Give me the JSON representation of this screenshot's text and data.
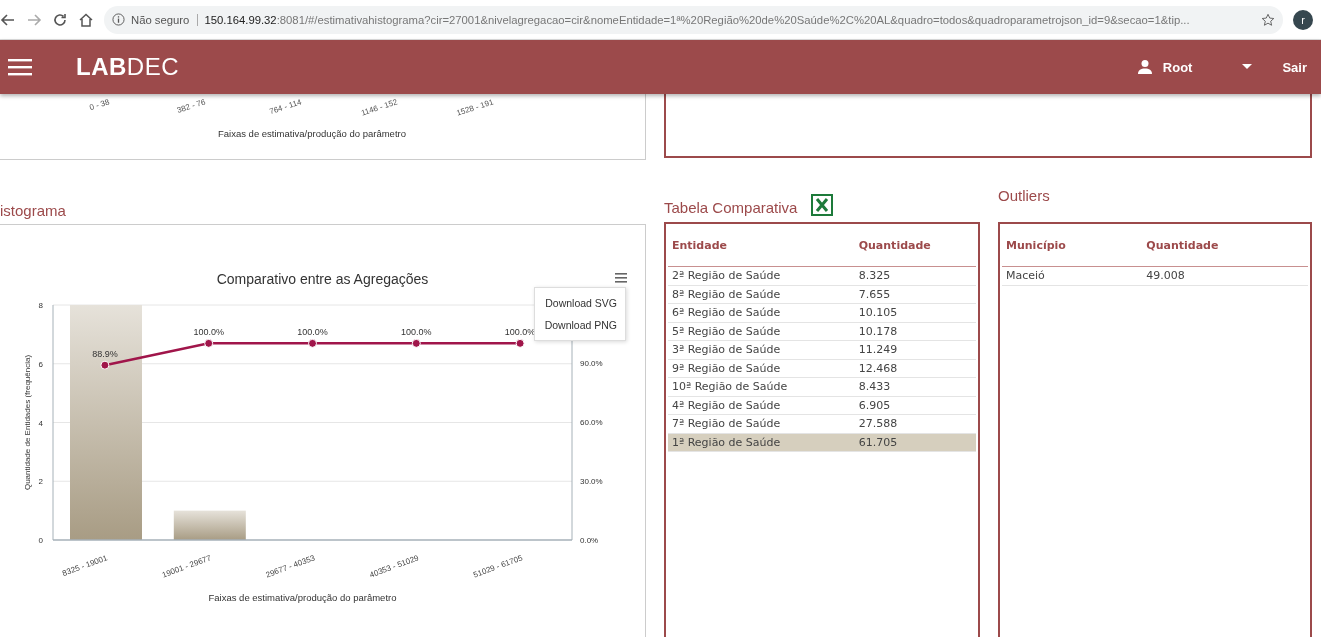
{
  "browser": {
    "security": "Não seguro",
    "url_host": "150.164.99.32",
    "url_rest": ":8081/#/estimativahistograma?cir=27001&nivelagregacao=cir&nomeEntidade=1ª%20Região%20de%20Saúde%2C%20AL&quadro=todos&quadroparametrojson_id=9&secao=1&tip...",
    "avatar": "r"
  },
  "header": {
    "logo_bold": "LAB",
    "logo_rest": "DEC",
    "user": "Root",
    "logout": "Sair"
  },
  "top_chart": {
    "xticks": [
      "0 - 38",
      "382 - 76",
      "764 - 114",
      "1146 - 152",
      "1528 - 191"
    ],
    "xlabel": "Faixas de estimativa/produção do parâmetro"
  },
  "histogram": {
    "title": "istograma",
    "menu": [
      "Download SVG",
      "Download PNG"
    ],
    "chart_data": {
      "type": "bar",
      "title": "Comparativo entre as Agregações",
      "xlabel": "Faixas de estimativa/produção do parâmetro",
      "ylabel": "Quantidade de Entidades (frequência)",
      "categories": [
        "8325 - 19001",
        "19001 - 29677",
        "29677 - 40353",
        "40353 - 51029",
        "51029 - 61705"
      ],
      "series": [
        {
          "color": "#a89c84",
          "values": [
            8,
            1,
            0,
            0,
            0
          ]
        }
      ],
      "ylim": [
        0,
        8
      ],
      "yticks": [
        0,
        2,
        4,
        6,
        8
      ],
      "grid": true
    },
    "cumulative": {
      "chart_data": {
        "type": "line",
        "series": [
          {
            "color": "#a0154a",
            "marker": "circle",
            "values": [
              88.9,
              100,
              100,
              100,
              100
            ]
          }
        ],
        "value_labels": [
          "88.9%",
          "100.0%",
          "100.0%",
          "100.0%",
          "100.0%"
        ],
        "ylim": [
          0,
          119.5
        ],
        "yticks": [
          {
            "value": 0,
            "label": "0.0%"
          },
          {
            "value": 30,
            "label": "30.0%"
          },
          {
            "value": 60,
            "label": "60.0%"
          },
          {
            "value": 90,
            "label": "90.0%"
          }
        ]
      }
    }
  },
  "comparison": {
    "title": "Tabela Comparativa",
    "columns": [
      "Entidade",
      "Quantidade"
    ],
    "rows": [
      {
        "cells": [
          "2ª Região de Saúde",
          "8.325"
        ],
        "selected": false
      },
      {
        "cells": [
          "8ª Região de Saúde",
          "7.655"
        ],
        "selected": false
      },
      {
        "cells": [
          "6ª Região de Saúde",
          "10.105"
        ],
        "selected": false
      },
      {
        "cells": [
          "5ª Região de Saúde",
          "10.178"
        ],
        "selected": false
      },
      {
        "cells": [
          "3ª Região de Saúde",
          "11.249"
        ],
        "selected": false
      },
      {
        "cells": [
          "9ª Região de Saúde",
          "12.468"
        ],
        "selected": false
      },
      {
        "cells": [
          "10ª Região de Saúde",
          "8.433"
        ],
        "selected": false
      },
      {
        "cells": [
          "4ª Região de Saúde",
          "6.905"
        ],
        "selected": false
      },
      {
        "cells": [
          "7ª Região de Saúde",
          "27.588"
        ],
        "selected": false
      },
      {
        "cells": [
          "1ª Região de Saúde",
          "61.705"
        ],
        "selected": true
      }
    ]
  },
  "outliers": {
    "title": "Outliers",
    "columns": [
      "Município",
      "Quantidade"
    ],
    "rows": [
      {
        "cells": [
          "Maceió",
          "49.008"
        ],
        "selected": false
      }
    ]
  }
}
